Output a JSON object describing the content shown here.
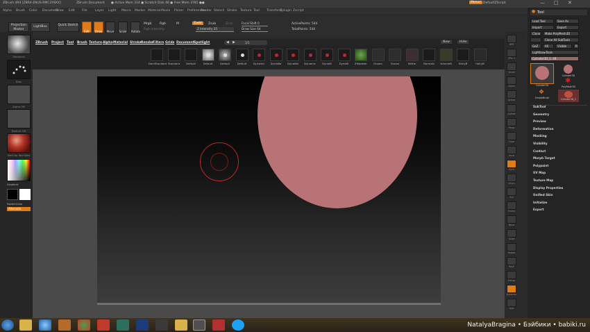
{
  "titlebar": {
    "app": "ZBrush 4R4 [ZBR4-ENUS-RMC3Y8XX]",
    "document": "ZBrush Document",
    "status": "● Active Mem 314 ● Scratch Disk 46 ● Free Mem 3781 ●●",
    "menus_label": "Menus",
    "script": "DefaultZScript"
  },
  "menubar": [
    "Alpha",
    "Brush",
    "Color",
    "Document",
    "Draw",
    "Edit",
    "File",
    "Layer",
    "Light",
    "Macro",
    "Marker",
    "Material",
    "Movie",
    "Picker",
    "Preferences",
    "Render",
    "Stencil",
    "Stroke",
    "Texture",
    "Tool",
    "Transform",
    "Zplugin",
    "Zscript"
  ],
  "toolbar": {
    "projection_master": "Projection Master",
    "lightbox": "LightBox",
    "quick_sketch": "Quick Sketch",
    "edit": "Edit",
    "draw": "Draw",
    "move": "Move",
    "scale": "Scale",
    "rotate": "Rotate",
    "mrgb": "Mrgb",
    "rgb": "Rgb",
    "m": "M",
    "rgb_intensity": "Rgb Intensity",
    "zadd": "Zadd",
    "zsub": "Zsub",
    "zcut": "Zcut",
    "z_intensity": "Z Intensity 25",
    "focal_shift": "Focal Shift 0",
    "draw_size": "Draw Size 64",
    "active_points": "ActivePoints: 544",
    "total_points": "TotalPoints: 544"
  },
  "palettes": [
    "ZBrush",
    "Project",
    "Tool",
    "Brush",
    "Texture",
    "Alpha",
    "Material",
    "Stroke",
    "Render",
    "Filters",
    "Grids",
    "Document",
    "Spotlight"
  ],
  "palette_tools": {
    "page_value": "1/1",
    "new": "New",
    "hide": "Hide"
  },
  "shelf_items": [
    "DamStandard",
    "Standard",
    "Default",
    "Default",
    "Default",
    "Default",
    "Dynamic",
    "DynaWa",
    "DynaWa",
    "Dynamic",
    "DynaW",
    "DynaW",
    "ZModeler",
    "Groom",
    "Groom",
    "Kettle",
    "Normals",
    "VolumeB",
    "HairyB",
    "HairyB"
  ],
  "left_shelf": {
    "brush_label": "Standard",
    "stroke_label": "Dots",
    "alpha_label": "Alpha Off",
    "texture_label": "Texture Off",
    "material_label": "MatCap Red Wax",
    "gradient_label": "Gradient",
    "switch_color": "SwitchColor",
    "alternate": "Alternate"
  },
  "right_shelf": [
    "BPR",
    "SPix 3",
    "Scroll",
    "Zoom",
    "Actual",
    "AAHalf",
    "Persp",
    "Floor",
    "Local",
    "Gyro",
    "LSym",
    "Xyz",
    "Frame",
    "Move",
    "Scale",
    "Rotate",
    "PolyF",
    "Transp",
    "Dynamic",
    "Solo"
  ],
  "tool_panel": {
    "title": "Tool",
    "load_tool": "Load Tool",
    "save_as": "Save As",
    "import": "Import",
    "export": "Export",
    "clone": "Clone",
    "make_polymesh": "Make PolyMesh3D",
    "goz": "GoZ",
    "all": "All",
    "visible": "Visible",
    "r": "R",
    "lightbox_tools": "Lightbox▸Tools",
    "current_tool": "Cylinder3D_1. 48",
    "clone_all": "Clone All SubTools",
    "thumbs": [
      "Cylinder3D",
      "Cylinder3D",
      "PolyMesh3D",
      "SimpleBrush",
      "Cylinder3D_1"
    ],
    "sections": [
      "SubTool",
      "Geometry",
      "Preview",
      "Deformation",
      "Masking",
      "Visibility",
      "Contact",
      "Morph Target",
      "Polypaint",
      "UV Map",
      "Texture Map",
      "Display Properties",
      "Unified Skin",
      "Initialize",
      "Export"
    ]
  },
  "watermark": "NatalyaBragina • Бэйбики • babiki.ru",
  "colors": {
    "accent_orange": "#e07b1a",
    "sphere_pink": "#b77376",
    "brush_cursor_red": "#c0262c"
  }
}
